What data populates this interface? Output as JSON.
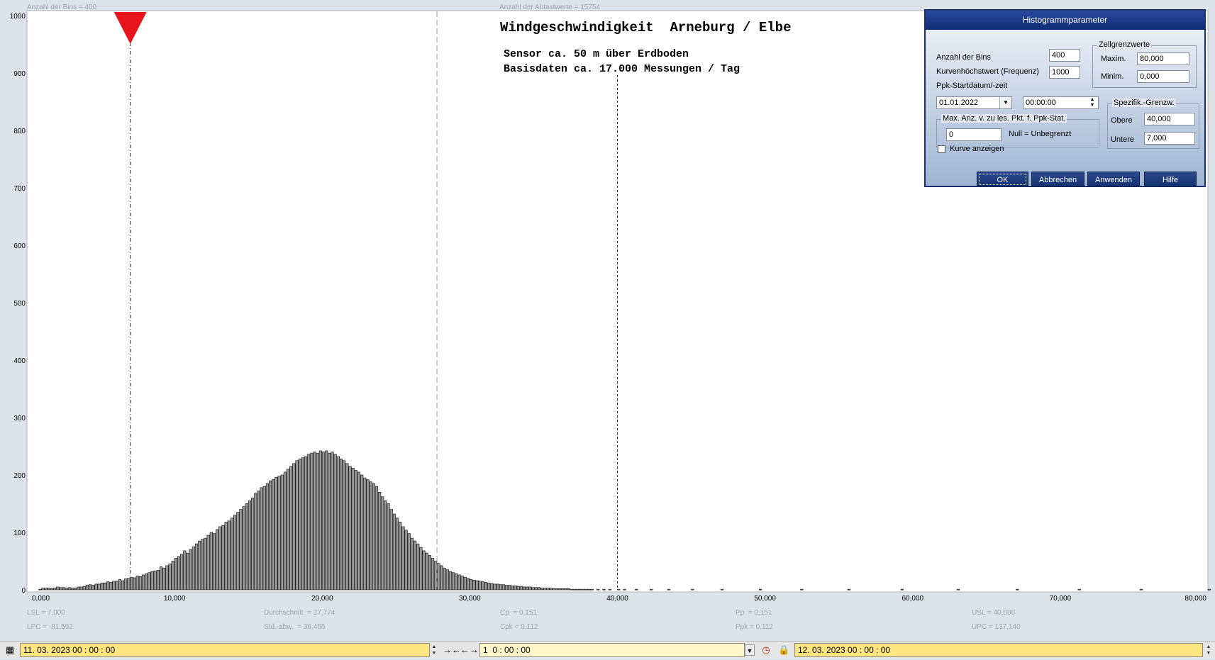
{
  "chart_data": {
    "type": "bar",
    "title": "Windgeschwindigkeit  Arneburg / Elbe",
    "subtitle_lines": [
      "Sensor ca. 50 m über Erdboden",
      "Basisdaten ca. 17.000 Messungen / Tag"
    ],
    "header_left": "Anzahl der Bins =   400",
    "header_center": "Anzahl der Abtastwerte = 15754",
    "xlim": [
      0,
      80
    ],
    "ylim": [
      0,
      1000
    ],
    "x_ticks": [
      "0,000",
      "10,000",
      "20,000",
      "30,000",
      "40,000",
      "50,000",
      "60,000",
      "70,000",
      "80,000"
    ],
    "y_ticks": [
      "0",
      "100",
      "200",
      "300",
      "400",
      "500",
      "600",
      "700",
      "800",
      "900",
      "1000"
    ],
    "grid": false,
    "bin_width": 0.2,
    "bin_start": 0,
    "values": [
      0,
      0,
      0,
      0,
      1,
      3,
      3,
      3,
      2,
      3,
      5,
      4,
      4,
      3,
      4,
      3,
      3,
      5,
      5,
      6,
      8,
      9,
      8,
      10,
      10,
      12,
      12,
      14,
      13,
      15,
      15,
      18,
      16,
      19,
      20,
      22,
      21,
      24,
      23,
      26,
      28,
      30,
      32,
      33,
      34,
      40,
      38,
      42,
      45,
      50,
      55,
      58,
      62,
      68,
      64,
      70,
      75,
      80,
      85,
      88,
      90,
      95,
      100,
      98,
      105,
      110,
      112,
      118,
      120,
      125,
      130,
      135,
      140,
      145,
      150,
      155,
      160,
      168,
      172,
      178,
      180,
      185,
      190,
      192,
      196,
      198,
      200,
      205,
      210,
      215,
      220,
      225,
      228,
      230,
      232,
      236,
      238,
      240,
      238,
      242,
      240,
      242,
      238,
      240,
      236,
      232,
      228,
      225,
      220,
      215,
      212,
      208,
      205,
      200,
      195,
      192,
      188,
      185,
      180,
      170,
      162,
      155,
      150,
      140,
      132,
      125,
      118,
      110,
      104,
      98,
      90,
      85,
      80,
      74,
      68,
      64,
      60,
      55,
      50,
      46,
      42,
      38,
      35,
      32,
      30,
      28,
      26,
      24,
      22,
      20,
      18,
      17,
      16,
      15,
      14,
      13,
      12,
      11,
      10,
      10,
      9,
      9,
      8,
      8,
      7,
      7,
      6,
      6,
      5,
      5,
      5,
      4,
      4,
      4,
      3,
      3,
      3,
      3,
      2,
      2,
      2,
      2,
      2,
      2,
      1,
      1,
      1,
      1,
      1,
      1,
      1,
      1,
      0,
      1,
      0,
      1,
      0,
      1,
      0,
      0,
      1,
      0,
      1,
      0,
      0,
      0,
      1,
      0,
      0,
      0,
      0,
      1,
      0,
      0,
      0,
      0,
      0,
      1,
      0,
      0,
      0,
      0,
      0,
      0,
      0,
      1,
      0,
      0,
      0,
      0,
      0,
      0,
      0,
      0,
      0,
      1,
      0,
      0,
      0,
      0,
      0,
      0,
      0,
      0,
      0,
      0,
      0,
      0,
      1,
      0,
      0,
      0,
      0,
      0,
      0,
      0,
      0,
      0,
      0,
      0,
      0,
      0,
      1,
      0,
      0,
      0,
      0,
      0,
      0,
      0,
      0,
      0,
      0,
      0,
      0,
      0,
      0,
      0,
      1,
      0,
      0,
      0,
      0,
      0,
      0,
      0,
      0,
      0,
      0,
      0,
      0,
      0,
      0,
      0,
      0,
      0,
      1,
      0,
      0,
      0,
      0,
      0,
      0,
      0,
      0,
      0,
      0,
      0,
      0,
      0,
      0,
      0,
      0,
      0,
      0,
      1,
      0,
      0,
      0,
      0,
      0,
      0,
      0,
      0,
      0,
      0,
      0,
      0,
      0,
      0,
      0,
      0,
      0,
      0,
      0,
      1,
      0,
      0,
      0,
      0,
      0,
      0,
      0,
      0,
      0,
      0,
      0,
      0,
      0,
      0,
      0,
      0,
      0,
      0,
      0,
      0,
      1,
      0,
      0,
      0,
      0,
      0,
      0,
      0,
      0,
      0,
      0,
      0,
      0,
      0,
      0,
      0,
      0,
      0,
      0,
      0,
      0,
      1,
      0,
      0,
      0,
      0,
      0,
      0,
      0,
      0,
      0,
      0,
      0,
      0,
      0,
      0,
      0,
      0,
      0,
      0,
      0,
      0,
      0,
      0,
      1,
      0,
      0,
      0,
      0,
      0,
      0,
      0,
      0
    ],
    "marker_lsl": 7.0,
    "marker_mean": 27.774,
    "marker_usl": 40.0,
    "stats": [
      [
        "LSL = 7,000",
        "Durchschnitt  = 27,774",
        "Cp  = 0,151",
        "Pp  = 0,151",
        "USL = 40,000"
      ],
      [
        "LPC = -81,592",
        "Std.-abw.  = 36,455",
        "Cpk = 0,112",
        "Ppk = 0,112",
        "UPC = 137,140"
      ]
    ]
  },
  "dialog": {
    "title": "Histogrammparameter",
    "bins_label": "Anzahl der Bins",
    "bins_value": "400",
    "peak_label": "Kurvenhöchstwert (Frequenz)",
    "peak_value": "1000",
    "start_label": "Ppk-Startdatum/-zeit",
    "start_date": "01.01.2022",
    "start_time": "00:00:00",
    "maxpts_group": "Max. Anz. v. zu les. Pkt. f. Ppk-Stat.",
    "maxpts_value": "0",
    "maxpts_hint": "Null = Unbegrenzt",
    "cell_group": "Zellgrenzwerte",
    "cell_max_label": "Maxim.",
    "cell_max_value": "80,000",
    "cell_min_label": "Minim.",
    "cell_min_value": "0,000",
    "spec_group": "Spezifik.-Grenzw.",
    "spec_upper_label": "Obere",
    "spec_upper_value": "40,000",
    "spec_lower_label": "Untere",
    "spec_lower_value": "7,000",
    "curve_label": "Kurve anzeigen",
    "curve_checked": false,
    "buttons": {
      "ok": "OK",
      "cancel": "Abbrechen",
      "apply": "Anwenden",
      "help": "Hilfe"
    }
  },
  "bottombar": {
    "start": "11. 03. 2023   00 : 00 : 00",
    "duration": "1  0 : 00 : 00",
    "end": "12. 03. 2023   00 : 00 : 00"
  }
}
